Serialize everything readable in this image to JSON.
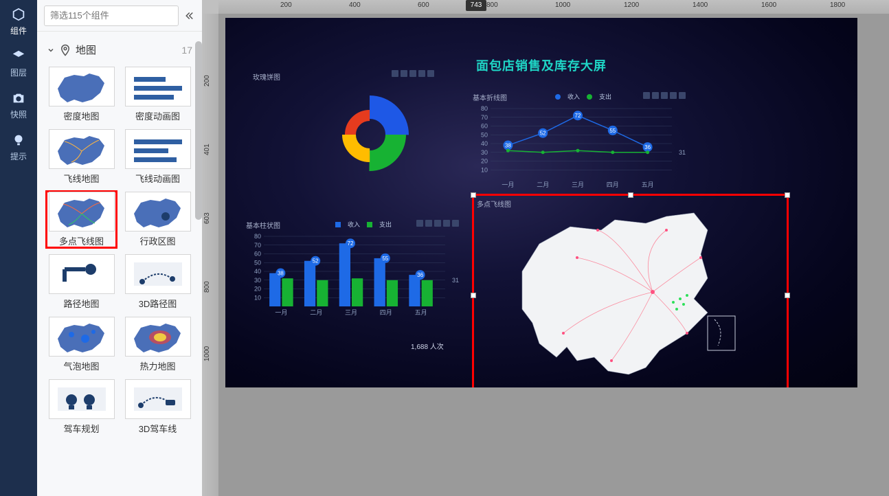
{
  "sidebar": {
    "items": [
      {
        "label": "组件"
      },
      {
        "label": "图层"
      },
      {
        "label": "快照"
      },
      {
        "label": "提示"
      }
    ]
  },
  "filter": {
    "placeholder": "筛选115个组件"
  },
  "category": {
    "name": "地图",
    "count": "17"
  },
  "components": [
    {
      "key": "density",
      "label": "密度地图"
    },
    {
      "key": "density-anim",
      "label": "密度动画图"
    },
    {
      "key": "flyline",
      "label": "飞线地图"
    },
    {
      "key": "flyline-anim",
      "label": "飞线动画图"
    },
    {
      "key": "multi-flyline",
      "label": "多点飞线图"
    },
    {
      "key": "admin",
      "label": "行政区图"
    },
    {
      "key": "route",
      "label": "路径地图"
    },
    {
      "key": "route3d",
      "label": "3D路径图"
    },
    {
      "key": "bubble",
      "label": "气泡地图"
    },
    {
      "key": "heat",
      "label": "热力地图"
    },
    {
      "key": "drive",
      "label": "驾车规划"
    },
    {
      "key": "drive3d",
      "label": "3D驾车线"
    }
  ],
  "selected_component_index": 4,
  "ruler": {
    "h_ticks": [
      "200",
      "400",
      "600",
      "800",
      "1000",
      "1200",
      "1400",
      "1600",
      "1800"
    ],
    "cursor_x": "743",
    "v_ticks": [
      "200",
      "401",
      "603",
      "800",
      "1000"
    ]
  },
  "dashboard": {
    "title": "面包店销售及库存大屏",
    "pie_label": "玫瑰饼图",
    "line_label": "基本折线图",
    "bar_label": "基本柱状图",
    "map_label": "多点飞线图",
    "legend_items": [
      "收入",
      "支出"
    ],
    "stat": "1,688 人次",
    "axis_last_label": "31.2"
  },
  "chart_data": [
    {
      "type": "line",
      "title": "基本折线图",
      "categories": [
        "一月",
        "二月",
        "三月",
        "四月",
        "五月"
      ],
      "series": [
        {
          "name": "收入",
          "values": [
            38,
            52,
            72,
            55,
            36
          ]
        },
        {
          "name": "支出",
          "values": [
            32,
            30,
            32,
            30,
            30
          ]
        }
      ],
      "ylim": [
        0,
        80
      ],
      "yticks": [
        10,
        20,
        30,
        40,
        50,
        60,
        70,
        80
      ]
    },
    {
      "type": "bar",
      "title": "基本柱状图",
      "categories": [
        "一月",
        "二月",
        "三月",
        "四月",
        "五月"
      ],
      "series": [
        {
          "name": "收入",
          "values": [
            38,
            52,
            72,
            55,
            36
          ]
        },
        {
          "name": "支出",
          "values": [
            32,
            30,
            32,
            30,
            30
          ]
        }
      ],
      "ylim": [
        0,
        80
      ],
      "yticks": [
        10,
        20,
        30,
        40,
        50,
        60,
        70,
        80
      ]
    },
    {
      "type": "pie",
      "title": "玫瑰饼图",
      "values": [
        25,
        25,
        25,
        25
      ],
      "colors": [
        "#1e58e6",
        "#17b233",
        "#ffbc00",
        "#e63b1e"
      ]
    }
  ]
}
